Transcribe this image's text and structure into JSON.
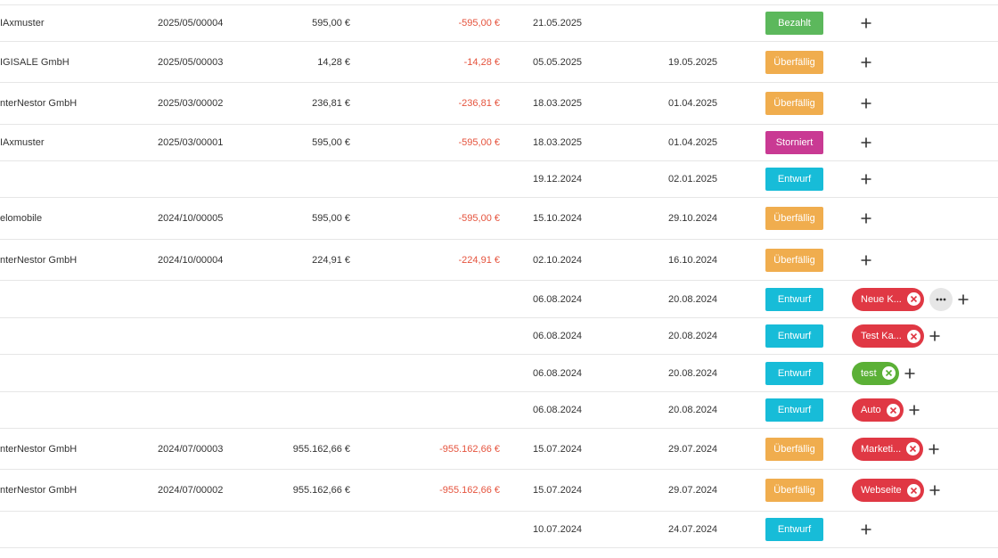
{
  "rows": [
    {
      "customer": "IAxmuster",
      "number": "2025/05/00004",
      "amount": "595,00 €",
      "open": "-595,00 €",
      "date": "21.05.2025",
      "due": "",
      "status": "Bezahlt",
      "status_type": "paid",
      "tags": []
    },
    {
      "customer": "IGISALE GmbH",
      "number": "2025/05/00003",
      "amount": "14,28 €",
      "open": "-14,28 €",
      "date": "05.05.2025",
      "due": "19.05.2025",
      "status": "Überfällig",
      "status_type": "overdue",
      "tags": []
    },
    {
      "customer": "nterNestor GmbH",
      "number": "2025/03/00002",
      "amount": "236,81 €",
      "open": "-236,81 €",
      "date": "18.03.2025",
      "due": "01.04.2025",
      "status": "Überfällig",
      "status_type": "overdue",
      "tags": []
    },
    {
      "customer": "IAxmuster",
      "number": "2025/03/00001",
      "amount": "595,00 €",
      "open": "-595,00 €",
      "date": "18.03.2025",
      "due": "01.04.2025",
      "status": "Storniert",
      "status_type": "cancelled",
      "tags": []
    },
    {
      "customer": "",
      "number": "",
      "amount": "",
      "open": "",
      "date": "19.12.2024",
      "due": "02.01.2025",
      "status": "Entwurf",
      "status_type": "draft",
      "tags": []
    },
    {
      "customer": "elomobile",
      "number": "2024/10/00005",
      "amount": "595,00 €",
      "open": "-595,00 €",
      "date": "15.10.2024",
      "due": "29.10.2024",
      "status": "Überfällig",
      "status_type": "overdue",
      "tags": []
    },
    {
      "customer": "nterNestor GmbH",
      "number": "2024/10/00004",
      "amount": "224,91 €",
      "open": "-224,91 €",
      "date": "02.10.2024",
      "due": "16.10.2024",
      "status": "Überfällig",
      "status_type": "overdue",
      "tags": []
    },
    {
      "customer": "",
      "number": "",
      "amount": "",
      "open": "",
      "date": "06.08.2024",
      "due": "20.08.2024",
      "status": "Entwurf",
      "status_type": "draft",
      "tags": [
        {
          "label": "Neue K...",
          "color": "red"
        }
      ],
      "more": true
    },
    {
      "customer": "",
      "number": "",
      "amount": "",
      "open": "",
      "date": "06.08.2024",
      "due": "20.08.2024",
      "status": "Entwurf",
      "status_type": "draft",
      "tags": [
        {
          "label": "Test Ka...",
          "color": "red"
        }
      ]
    },
    {
      "customer": "",
      "number": "",
      "amount": "",
      "open": "",
      "date": "06.08.2024",
      "due": "20.08.2024",
      "status": "Entwurf",
      "status_type": "draft",
      "tags": [
        {
          "label": "test",
          "color": "green"
        }
      ]
    },
    {
      "customer": "",
      "number": "",
      "amount": "",
      "open": "",
      "date": "06.08.2024",
      "due": "20.08.2024",
      "status": "Entwurf",
      "status_type": "draft",
      "tags": [
        {
          "label": "Auto",
          "color": "red"
        }
      ]
    },
    {
      "customer": "nterNestor GmbH",
      "number": "2024/07/00003",
      "amount": "955.162,66 €",
      "open": "-955.162,66 €",
      "date": "15.07.2024",
      "due": "29.07.2024",
      "status": "Überfällig",
      "status_type": "overdue",
      "tags": [
        {
          "label": "Marketi...",
          "color": "red"
        }
      ]
    },
    {
      "customer": "nterNestor GmbH",
      "number": "2024/07/00002",
      "amount": "955.162,66 €",
      "open": "-955.162,66 €",
      "date": "15.07.2024",
      "due": "29.07.2024",
      "status": "Überfällig",
      "status_type": "overdue",
      "tags": [
        {
          "label": "Webseite",
          "color": "red"
        }
      ]
    },
    {
      "customer": "",
      "number": "",
      "amount": "",
      "open": "",
      "date": "10.07.2024",
      "due": "24.07.2024",
      "status": "Entwurf",
      "status_type": "draft",
      "tags": []
    }
  ],
  "colors": {
    "open_amount": "#e5533d",
    "paid": "#5cb85c",
    "overdue": "#f0ad4e",
    "cancelled": "#c93a93",
    "draft": "#17bcd8",
    "tag_red": "#e03844",
    "tag_green": "#5bb036"
  },
  "icons": {
    "add": "plus-icon",
    "remove_tag": "close-circle-icon",
    "more": "ellipsis-icon"
  }
}
